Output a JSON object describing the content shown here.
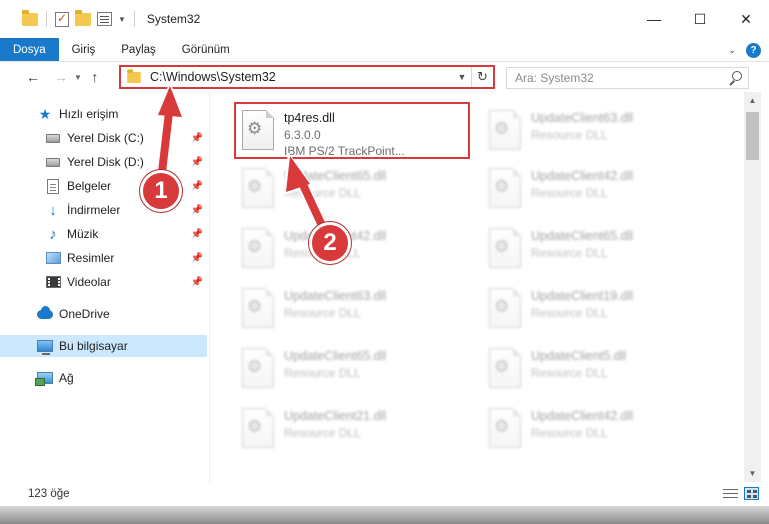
{
  "window": {
    "title": "System32",
    "minimize": "—",
    "maximize": "☐",
    "close": "✕"
  },
  "ribbon": {
    "tabs": [
      "Dosya",
      "Giriş",
      "Paylaş",
      "Görünüm"
    ],
    "help": "?"
  },
  "nav": {
    "back": "←",
    "forward": "→",
    "up": "↑",
    "address": "C:\\Windows\\System32",
    "search_placeholder": "Ara: System32",
    "refresh": "↻"
  },
  "sidebar": {
    "items": [
      {
        "label": "Hızlı erişim",
        "icon": "star-icon"
      },
      {
        "label": "Yerel Disk (C:)",
        "icon": "drive-icon",
        "pinned": true
      },
      {
        "label": "Yerel Disk (D:)",
        "icon": "drive-icon",
        "pinned": true
      },
      {
        "label": "Belgeler",
        "icon": "documents-icon",
        "pinned": true
      },
      {
        "label": "İndirmeler",
        "icon": "downloads-icon",
        "pinned": true
      },
      {
        "label": "Müzik",
        "icon": "music-icon",
        "pinned": true
      },
      {
        "label": "Resimler",
        "icon": "pictures-icon",
        "pinned": true
      },
      {
        "label": "Videolar",
        "icon": "videos-icon",
        "pinned": true
      },
      {
        "label": "OneDrive",
        "icon": "cloud-icon"
      },
      {
        "label": "Bu bilgisayar",
        "icon": "computer-icon",
        "selected": true
      },
      {
        "label": "Ağ",
        "icon": "network-icon"
      }
    ]
  },
  "files": {
    "highlighted": {
      "name": "tp4res.dll",
      "version": "6.3.0.0",
      "description": "IBM PS/2 TrackPoint..."
    },
    "left_column": [
      {
        "name": "UpdateClient65.dll",
        "type": "Resource DLL"
      },
      {
        "name": "UpdateClient42.dll",
        "type": "Resource DLL"
      },
      {
        "name": "UpdateClient63.dll",
        "type": "Resource DLL"
      },
      {
        "name": "UpdateClient65.dll",
        "type": "Resource DLL"
      },
      {
        "name": "UpdateClient21.dll",
        "type": "Resource DLL"
      }
    ],
    "right_column": [
      {
        "name": "UpdateClient63.dll",
        "type": "Resource DLL"
      },
      {
        "name": "UpdateClient42.dll",
        "type": "Resource DLL"
      },
      {
        "name": "UpdateClient65.dll",
        "type": "Resource DLL"
      },
      {
        "name": "UpdateClient19.dll",
        "type": "Resource DLL"
      },
      {
        "name": "UpdateClient5.dll",
        "type": "Resource DLL"
      },
      {
        "name": "UpdateClient42.dll",
        "type": "Resource DLL"
      }
    ]
  },
  "status": {
    "item_count": "123 öğe"
  },
  "annotations": {
    "step1": "1",
    "step2": "2",
    "color": "#d8393b"
  }
}
